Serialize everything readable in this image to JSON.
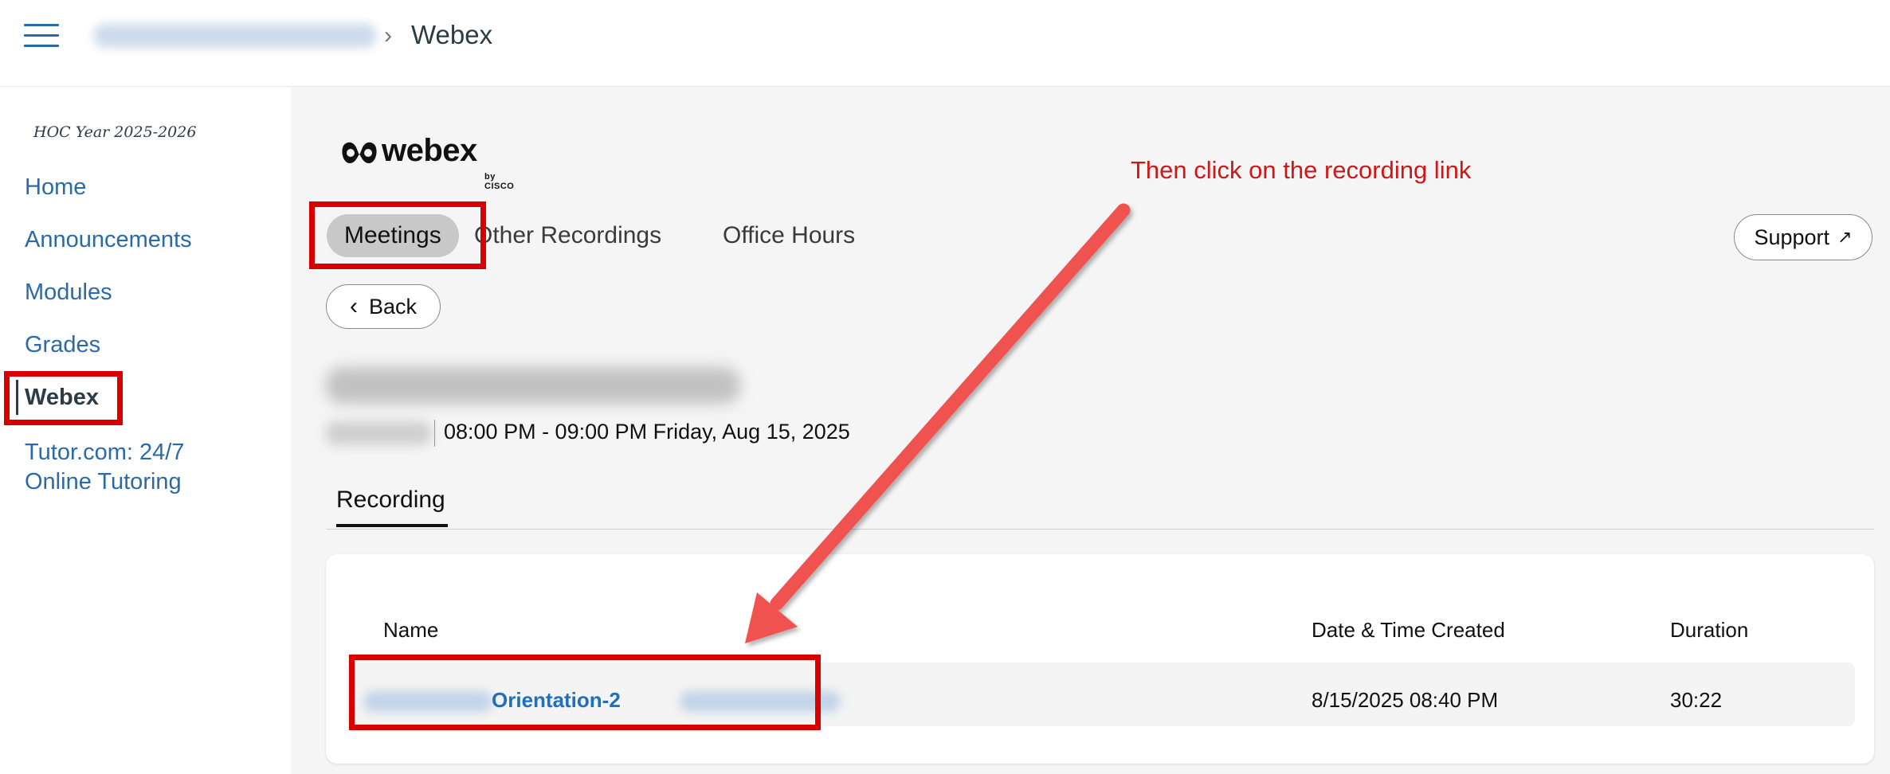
{
  "header": {
    "breadcrumb_current": "Webex",
    "breadcrumb_separator": "›"
  },
  "sidebar": {
    "term": "HOC Year 2025-2026",
    "items": [
      {
        "label": "Home"
      },
      {
        "label": "Announcements"
      },
      {
        "label": "Modules"
      },
      {
        "label": "Grades"
      },
      {
        "label": "Webex"
      },
      {
        "label": "Tutor.com: 24/7"
      },
      {
        "label": "Online Tutoring"
      }
    ]
  },
  "webex": {
    "logo_text": "webex",
    "logo_sub": "by CISCO",
    "tabs": [
      {
        "label": "Meetings"
      },
      {
        "label": "Other Recordings"
      },
      {
        "label": "Office Hours"
      }
    ],
    "support_label": "Support",
    "back_label": "Back",
    "meeting_time": "08:00 PM - 09:00 PM Friday, Aug 15, 2025",
    "subtab_label": "Recording",
    "table": {
      "headers": [
        "Name",
        "Date & Time Created",
        "Duration"
      ],
      "rows": [
        {
          "name_visible": "Orientation-2",
          "created": "8/15/2025 08:40 PM",
          "duration": "30:22"
        }
      ]
    }
  },
  "annotation": {
    "callout_text": "Then click on the recording link",
    "highlight_color": "#d90000",
    "arrow_color": "#f0524f"
  }
}
